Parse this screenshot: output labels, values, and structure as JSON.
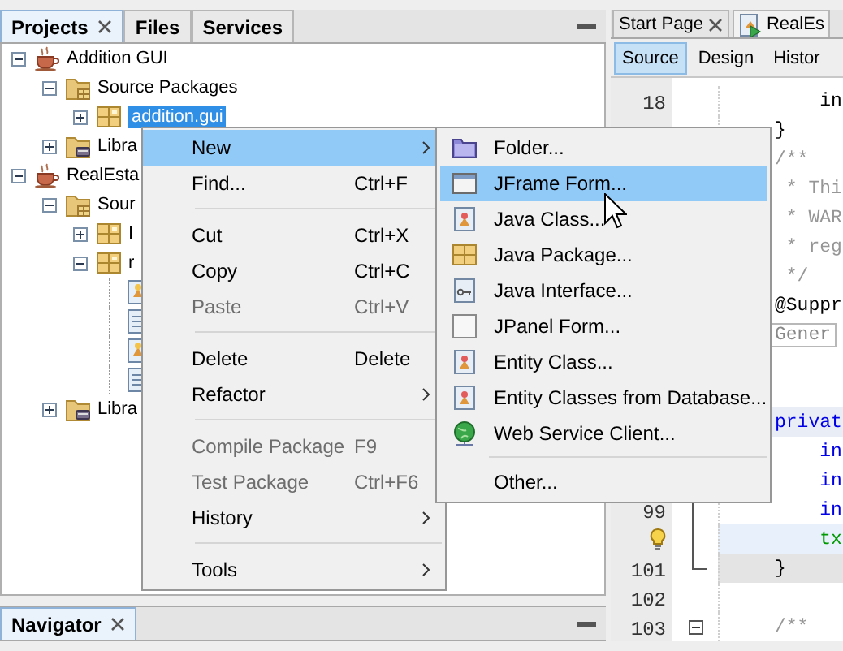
{
  "projects_panel": {
    "tabs": [
      {
        "label": "Projects",
        "selected": true,
        "closable": true
      },
      {
        "label": "Files",
        "selected": false,
        "closable": false
      },
      {
        "label": "Services",
        "selected": false,
        "closable": false
      }
    ],
    "tree": [
      {
        "label": "Addition GUI",
        "kind": "project",
        "expanded": true,
        "selected": false,
        "children": [
          {
            "label": "Source Packages",
            "kind": "source-folder",
            "expanded": true,
            "selected": false,
            "children": [
              {
                "label": "addition.gui",
                "kind": "package",
                "expanded": false,
                "selected": true
              }
            ]
          },
          {
            "label": "Libra",
            "kind": "library",
            "expanded": false,
            "selected": false
          }
        ]
      },
      {
        "label": "RealEsta",
        "kind": "project",
        "expanded": true,
        "selected": false,
        "children": [
          {
            "label": "Sour",
            "kind": "source-folder",
            "expanded": true,
            "selected": false,
            "children": [
              {
                "label": "I",
                "kind": "package",
                "expanded": false,
                "selected": false
              },
              {
                "label": "r",
                "kind": "package",
                "expanded": true,
                "selected": false,
                "children": [
                  {
                    "kind": "bean-file",
                    "selected": false
                  },
                  {
                    "kind": "source-file",
                    "selected": false
                  },
                  {
                    "kind": "bean-file",
                    "selected": false
                  },
                  {
                    "kind": "source-file",
                    "selected": false
                  }
                ]
              }
            ]
          },
          {
            "label": "Libra",
            "kind": "library",
            "expanded": false,
            "selected": false
          }
        ]
      }
    ]
  },
  "navigator_panel": {
    "tabs": [
      {
        "label": "Navigator",
        "selected": true,
        "closable": true
      }
    ]
  },
  "editor": {
    "tabs": [
      {
        "label": "Start Page",
        "selected": false,
        "closable": true,
        "kind": "plain"
      },
      {
        "label": "RealEs",
        "selected": true,
        "closable": false,
        "kind": "runnable"
      }
    ],
    "views": [
      {
        "label": "Source",
        "selected": true
      },
      {
        "label": "Design",
        "selected": false
      },
      {
        "label": "Histor",
        "selected": false
      }
    ],
    "lines": [
      {
        "number": "18",
        "kind": "plain",
        "text": "    in"
      },
      {
        "kind": "plain",
        "text": "}"
      },
      {
        "kind": "comment",
        "text": "/**"
      },
      {
        "kind": "comment",
        "text": " * Thi"
      },
      {
        "kind": "comment",
        "text": " * WAR"
      },
      {
        "kind": "comment",
        "text": " * reg"
      },
      {
        "kind": "comment",
        "text": " */"
      },
      {
        "kind": "plain",
        "text": "@Suppr"
      },
      {
        "kind": "folded",
        "text": "Gener"
      },
      {
        "kind": "blank"
      },
      {
        "kind": "blank"
      },
      {
        "kind": "keyword",
        "text": "privat"
      },
      {
        "kind": "field",
        "text": "    in"
      },
      {
        "kind": "field",
        "text": "    in"
      },
      {
        "number": "99",
        "kind": "field",
        "text": "    in"
      },
      {
        "kind": "statement",
        "text": "    tx",
        "hint": true
      },
      {
        "number": "101",
        "kind": "block-end",
        "text": "}"
      },
      {
        "number": "102",
        "kind": "blank"
      },
      {
        "number": "103",
        "kind": "comment",
        "text": "/**"
      }
    ]
  },
  "context_menu": {
    "items": [
      {
        "kind": "item",
        "label": "New",
        "submenu": true,
        "selected": true,
        "disabled": false
      },
      {
        "kind": "item",
        "label": "Find...",
        "shortcut": "Ctrl+F",
        "submenu": false,
        "selected": false,
        "disabled": false
      },
      {
        "kind": "separator"
      },
      {
        "kind": "item",
        "label": "Cut",
        "shortcut": "Ctrl+X",
        "submenu": false,
        "selected": false,
        "disabled": false
      },
      {
        "kind": "item",
        "label": "Copy",
        "shortcut": "Ctrl+C",
        "submenu": false,
        "selected": false,
        "disabled": false
      },
      {
        "kind": "item",
        "label": "Paste",
        "shortcut": "Ctrl+V",
        "submenu": false,
        "selected": false,
        "disabled": true
      },
      {
        "kind": "separator"
      },
      {
        "kind": "item",
        "label": "Delete",
        "shortcut": "Delete",
        "submenu": false,
        "selected": false,
        "disabled": false
      },
      {
        "kind": "item",
        "label": "Refactor",
        "submenu": true,
        "selected": false,
        "disabled": false
      },
      {
        "kind": "separator"
      },
      {
        "kind": "item",
        "label": "Compile Package",
        "shortcut": "F9",
        "submenu": false,
        "selected": false,
        "disabled": true
      },
      {
        "kind": "item",
        "label": "Test Package",
        "shortcut": "Ctrl+F6",
        "submenu": false,
        "selected": false,
        "disabled": true
      },
      {
        "kind": "item",
        "label": "History",
        "submenu": true,
        "selected": false,
        "disabled": false
      },
      {
        "kind": "separator"
      },
      {
        "kind": "item",
        "label": "Tools",
        "submenu": true,
        "selected": false,
        "disabled": false
      }
    ]
  },
  "new_submenu": {
    "items": [
      {
        "kind": "item",
        "label": "Folder...",
        "selected": false
      },
      {
        "kind": "item",
        "label": "JFrame Form...",
        "selected": true
      },
      {
        "kind": "item",
        "label": "Java Class...",
        "selected": false
      },
      {
        "kind": "item",
        "label": "Java Package...",
        "selected": false
      },
      {
        "kind": "item",
        "label": "Java Interface...",
        "selected": false
      },
      {
        "kind": "item",
        "label": "JPanel Form...",
        "selected": false
      },
      {
        "kind": "item",
        "label": "Entity Class...",
        "selected": false
      },
      {
        "kind": "item",
        "label": "Entity Classes from Database...",
        "selected": false
      },
      {
        "kind": "item",
        "label": "Web Service Client...",
        "selected": false
      },
      {
        "kind": "separator"
      },
      {
        "kind": "item",
        "label": "Other...",
        "selected": false
      }
    ]
  }
}
